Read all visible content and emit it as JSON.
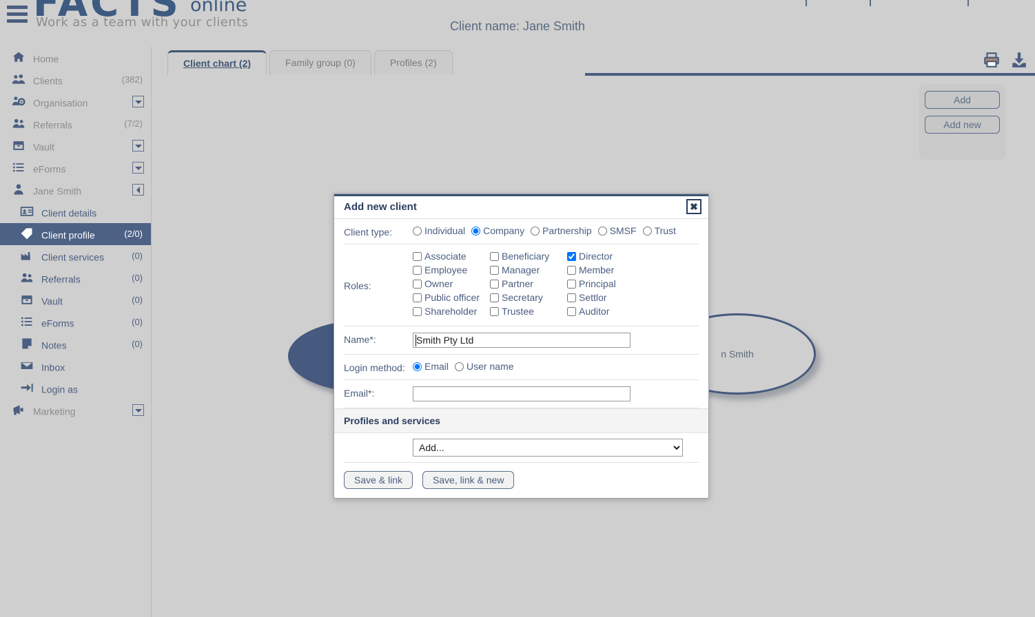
{
  "app": {
    "logo_main": "FACTS",
    "logo_suffix": "online",
    "tagline": "Work as a team with your clients",
    "client_name_header": "Client name: Jane Smith"
  },
  "sidebar": {
    "items": [
      {
        "label": "Home",
        "icon": "home-icon",
        "count": "",
        "control": "none",
        "level": "top",
        "selected": false
      },
      {
        "label": "Clients",
        "icon": "clients-icon",
        "count": "(382)",
        "control": "none",
        "level": "top",
        "selected": false
      },
      {
        "label": "Organisation",
        "icon": "organisation-icon",
        "count": "",
        "control": "down",
        "level": "top",
        "selected": false
      },
      {
        "label": "Referrals",
        "icon": "referrals-icon",
        "count": "(7/2)",
        "control": "none",
        "level": "top",
        "selected": false
      },
      {
        "label": "Vault",
        "icon": "vault-icon",
        "count": "",
        "control": "down",
        "level": "top",
        "selected": false
      },
      {
        "label": "eForms",
        "icon": "eforms-icon",
        "count": "",
        "control": "down",
        "level": "top",
        "selected": false
      },
      {
        "label": "Jane Smith",
        "icon": "user-icon",
        "count": "",
        "control": "left",
        "level": "top",
        "selected": false
      },
      {
        "label": "Client details",
        "icon": "id-card-icon",
        "count": "",
        "control": "none",
        "level": "sub",
        "selected": false
      },
      {
        "label": "Client profile",
        "icon": "tag-icon",
        "count": "(2/0)",
        "control": "none",
        "level": "sub",
        "selected": true
      },
      {
        "label": "Client services",
        "icon": "factory-icon",
        "count": "(0)",
        "control": "none",
        "level": "sub",
        "selected": false
      },
      {
        "label": "Referrals",
        "icon": "referrals-icon",
        "count": "(0)",
        "control": "none",
        "level": "sub",
        "selected": false
      },
      {
        "label": "Vault",
        "icon": "vault-icon",
        "count": "(0)",
        "control": "none",
        "level": "sub",
        "selected": false
      },
      {
        "label": "eForms",
        "icon": "eforms-icon",
        "count": "(0)",
        "control": "none",
        "level": "sub",
        "selected": false
      },
      {
        "label": "Notes",
        "icon": "notes-icon",
        "count": "(0)",
        "control": "none",
        "level": "sub",
        "selected": false
      },
      {
        "label": "Inbox",
        "icon": "inbox-icon",
        "count": "",
        "control": "none",
        "level": "sub",
        "selected": false
      },
      {
        "label": "Login as",
        "icon": "login-as-icon",
        "count": "",
        "control": "none",
        "level": "sub",
        "selected": false
      },
      {
        "label": "Marketing",
        "icon": "marketing-icon",
        "count": "",
        "control": "down",
        "level": "top",
        "selected": false
      }
    ]
  },
  "main": {
    "tabs": [
      {
        "label": "Client chart (2)",
        "active": true
      },
      {
        "label": "Family group (0)",
        "active": false
      },
      {
        "label": "Profiles (2)",
        "active": false
      }
    ],
    "tools": [
      {
        "name": "print-icon"
      },
      {
        "name": "download-icon"
      }
    ],
    "add_panel": {
      "add_label": "Add",
      "add_new_label": "Add new"
    },
    "chart_nodes": [
      {
        "label": "",
        "style": "filled"
      },
      {
        "label": "n Smith",
        "style": "outline"
      }
    ]
  },
  "modal": {
    "title": "Add new client",
    "close_glyph": "✖",
    "client_type": {
      "label": "Client type:",
      "options": [
        "Individual",
        "Company",
        "Partnership",
        "SMSF",
        "Trust"
      ],
      "selected": "Company"
    },
    "roles": {
      "label": "Roles:",
      "columns": [
        [
          "Associate",
          "Employee",
          "Owner",
          "Public officer",
          "Shareholder"
        ],
        [
          "Beneficiary",
          "Manager",
          "Partner",
          "Secretary",
          "Trustee"
        ],
        [
          "Director",
          "Member",
          "Principal",
          "Settlor",
          "Auditor"
        ]
      ],
      "checked": [
        "Director"
      ]
    },
    "name": {
      "label": "Name*:",
      "value": "Smith Pty Ltd",
      "placeholder": ""
    },
    "login_method": {
      "label": "Login method:",
      "options": [
        "Email",
        "User name"
      ],
      "selected": "Email"
    },
    "email": {
      "label": "Email*:",
      "value": "",
      "placeholder": ""
    },
    "profiles_section": {
      "heading": "Profiles and services",
      "select_value": "Add...",
      "select_options": [
        "Add..."
      ]
    },
    "actions": {
      "save_link": "Save & link",
      "save_link_new": "Save, link & new"
    }
  },
  "colors": {
    "page_bg": "#cfcfcf",
    "accent_blue": "#46597e",
    "selected_nav": "#4d6185",
    "logo_gold": "#e3a81e",
    "modal_title": "#2c3e60"
  }
}
